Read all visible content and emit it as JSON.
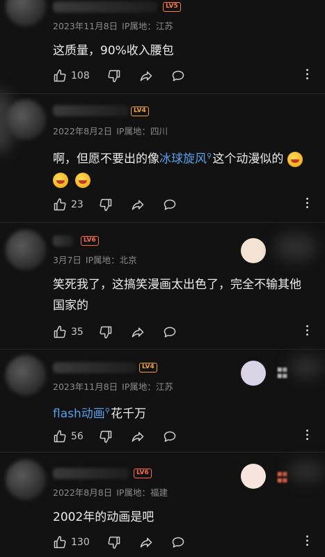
{
  "comments": [
    {
      "level": "LV5",
      "date": "2023年11月8日",
      "location": "IP属地：江苏",
      "text": "这质量，90%收入腰包",
      "likes": "108"
    },
    {
      "level": "LV4",
      "date": "2022年8月2日",
      "location": "IP属地：四川",
      "text_before": "啊，但愿不要出的像",
      "link": "冰球旋风",
      "text_after": "这个动漫似的",
      "likes": "23"
    },
    {
      "level": "LV6",
      "date": "3月7日",
      "location": "IP属地：北京",
      "text": "笑死我了，这搞笑漫画太出色了，完全不输其他国家的",
      "likes": "35"
    },
    {
      "level": "LV4",
      "date": "2023年11月8日",
      "location": "IP属地：江苏",
      "link": "flash动画",
      "text_after": "花千万",
      "likes": "56"
    },
    {
      "level": "LV6",
      "date": "2022年8月8日",
      "location": "IP属地：福建",
      "text": "2002年的动画是吧",
      "likes": "130"
    }
  ],
  "icons": {
    "like": "thumbs-up-icon",
    "dislike": "thumbs-down-icon",
    "share": "share-arrow-icon",
    "reply": "chat-bubble-icon",
    "more": "more-vertical-icon"
  },
  "colors": {
    "background": "#121212",
    "link": "#5aa0e8",
    "level_badge": "#ff6b4a",
    "meta_text": "#8b8b8b"
  }
}
